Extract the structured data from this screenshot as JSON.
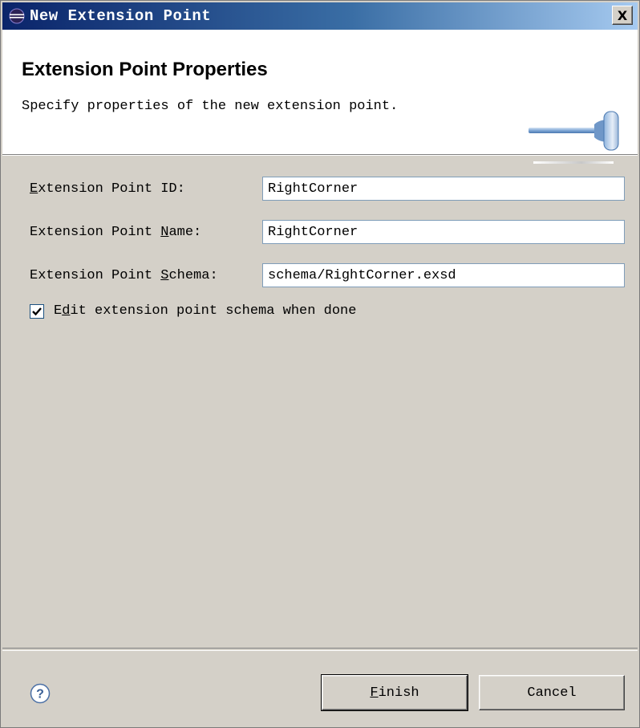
{
  "window": {
    "title": "New Extension Point",
    "close_label": "X"
  },
  "banner": {
    "title": "Extension Point Properties",
    "description": "Specify properties of the new extension point."
  },
  "form": {
    "id_label_mnemonic": "E",
    "id_label_rest": "xtension Point ID:",
    "id_value": "RightCorner",
    "name_label_pre": "Extension Point ",
    "name_label_mnemonic": "N",
    "name_label_post": "ame:",
    "name_value": "RightCorner",
    "schema_label_pre": "Extension Point ",
    "schema_label_mnemonic": "S",
    "schema_label_post": "chema:",
    "schema_value": "schema/RightCorner.exsd",
    "checkbox_checked": true,
    "checkbox_label_pre": "E",
    "checkbox_label_mnemonic": "d",
    "checkbox_label_post": "it extension point schema when done"
  },
  "footer": {
    "finish_mnemonic": "F",
    "finish_rest": "inish",
    "cancel_label": "Cancel"
  },
  "colors": {
    "titlebar_start": "#0a246a",
    "titlebar_end": "#a6caf0",
    "dialog_bg": "#d4d0c8"
  }
}
